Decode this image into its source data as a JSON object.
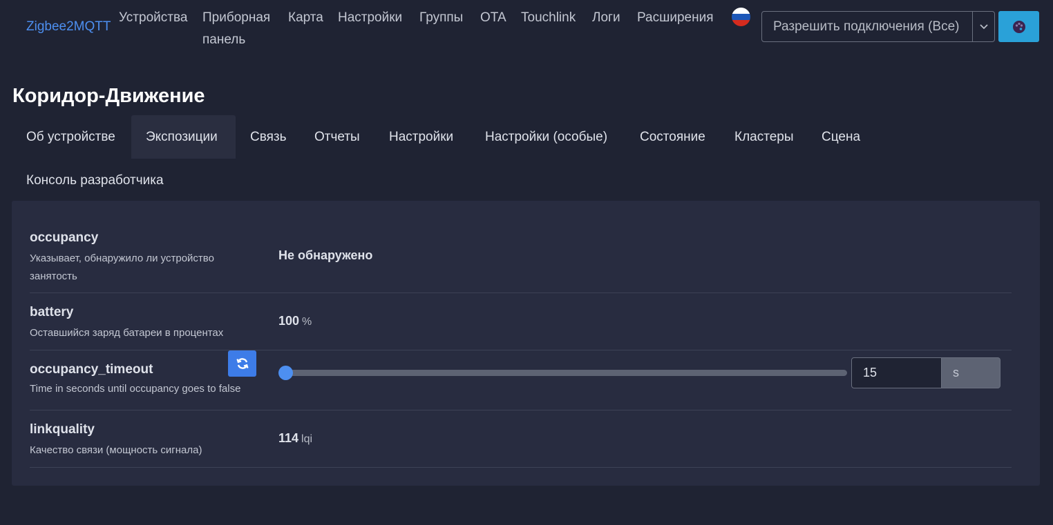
{
  "navbar": {
    "brand": "Zigbee2MQTT",
    "items": [
      {
        "label": "Устройства"
      },
      {
        "label": "Приборная панель"
      },
      {
        "label": "Карта"
      },
      {
        "label": "Настройки"
      },
      {
        "label": "Группы"
      },
      {
        "label": "OTA"
      },
      {
        "label": "Touchlink"
      },
      {
        "label": "Логи"
      },
      {
        "label": "Расширения"
      }
    ],
    "permit_join_label": "Разрешить подключения (Все)",
    "flag_colors": [
      "#ffffff",
      "#1c57b8",
      "#d52b1e"
    ],
    "theme_button_color": "#2aa1d8",
    "brand_color": "#4d8ff0"
  },
  "device": {
    "title": "Коридор-Движение"
  },
  "tabs": [
    {
      "label": "Об устройстве"
    },
    {
      "label": "Экспозиции",
      "active": true
    },
    {
      "label": "Связь"
    },
    {
      "label": "Отчеты"
    },
    {
      "label": "Настройки"
    },
    {
      "label": "Настройки (особые)"
    },
    {
      "label": "Состояние"
    },
    {
      "label": "Кластеры"
    },
    {
      "label": "Сцена"
    },
    {
      "label": "Консоль разработчика"
    }
  ],
  "exposes": [
    {
      "name": "occupancy",
      "description": "Указывает, обнаружило ли устройство занятость",
      "value": "Не обнаружено"
    },
    {
      "name": "battery",
      "description": "Оставшийся заряд батареи в процентах",
      "value": "100",
      "unit": "%"
    },
    {
      "name": "occupancy_timeout",
      "description": "Time in seconds until occupancy goes to false",
      "value": "15",
      "unit": "s",
      "slider_position": 0
    },
    {
      "name": "linkquality",
      "description": "Качество связи (мощность сигнала)",
      "value": "114",
      "unit": "lqi"
    }
  ],
  "colors": {
    "background": "#1f2333",
    "card": "#282c40",
    "accent": "#3d7ce8"
  }
}
